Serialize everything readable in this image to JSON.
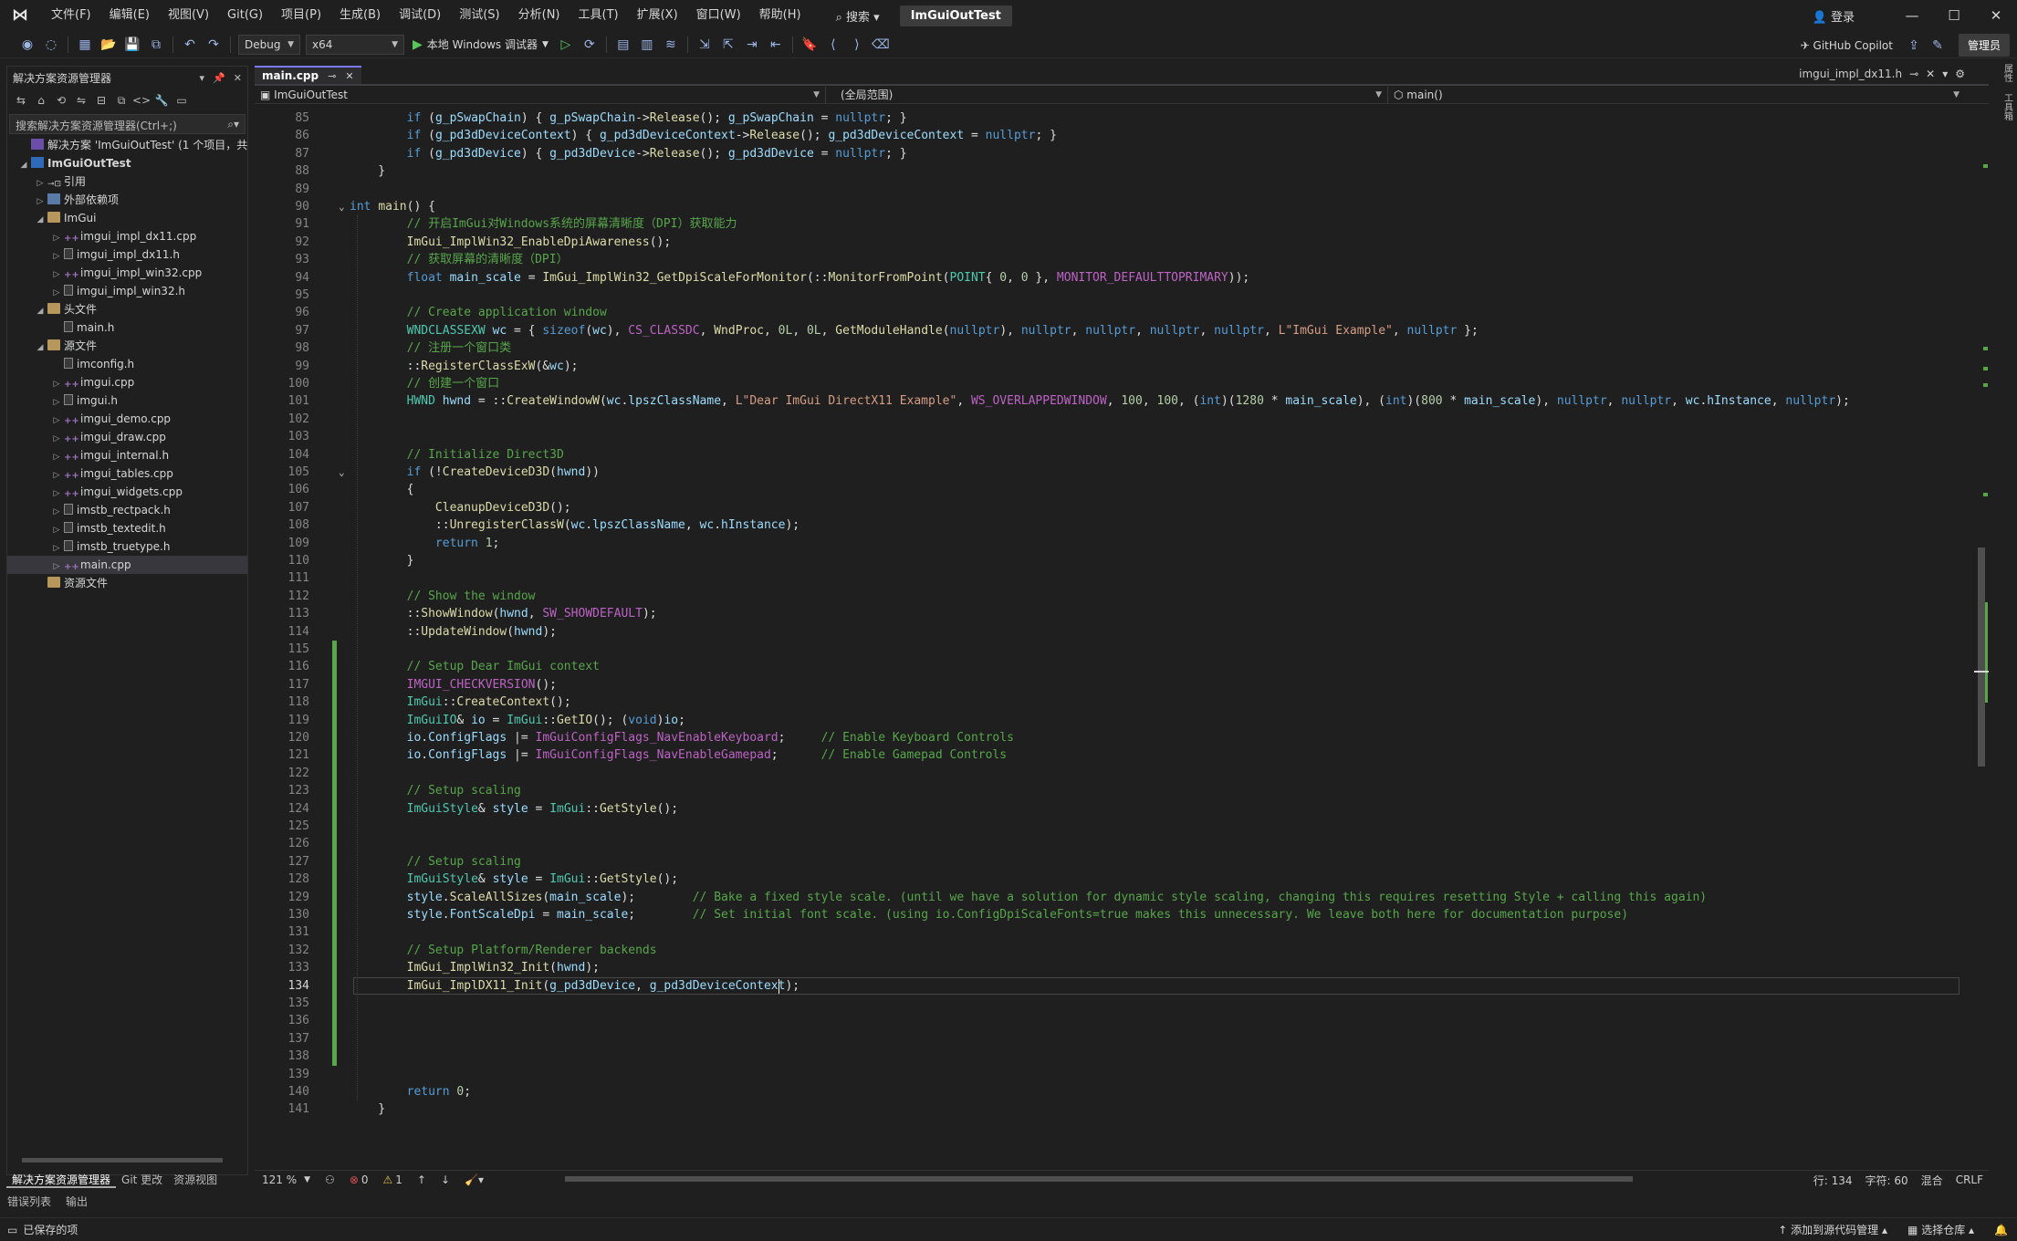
{
  "titlebar": {
    "menus": [
      "文件(F)",
      "编辑(E)",
      "视图(V)",
      "Git(G)",
      "项目(P)",
      "生成(B)",
      "调试(D)",
      "测试(S)",
      "分析(N)",
      "工具(T)",
      "扩展(X)",
      "窗口(W)",
      "帮助(H)"
    ],
    "search_label": "搜索",
    "solution_name": "ImGuiOutTest",
    "login": "登录"
  },
  "toolbar": {
    "config": "Debug",
    "platform": "x64",
    "run_label": "本地 Windows 调试器",
    "copilot": "GitHub Copilot",
    "admin": "管理员"
  },
  "solution_explorer": {
    "title": "解决方案资源管理器",
    "search_placeholder": "搜索解决方案资源管理器(Ctrl+;)",
    "items": [
      {
        "label": "解决方案 'ImGuiOutTest' (1 个项目，共 1",
        "indent": 0,
        "icon": "sln",
        "exp": ""
      },
      {
        "label": "ImGuiOutTest",
        "indent": 0,
        "icon": "proj",
        "exp": "◢",
        "bold": true
      },
      {
        "label": "引用",
        "indent": 1,
        "icon": "ref",
        "exp": "▷"
      },
      {
        "label": "外部依赖项",
        "indent": 1,
        "icon": "ext",
        "exp": "▷"
      },
      {
        "label": "ImGui",
        "indent": 1,
        "icon": "folder",
        "exp": "◢"
      },
      {
        "label": "imgui_impl_dx11.cpp",
        "indent": 2,
        "icon": "cpp",
        "exp": "▷"
      },
      {
        "label": "imgui_impl_dx11.h",
        "indent": 2,
        "icon": "h",
        "exp": "▷"
      },
      {
        "label": "imgui_impl_win32.cpp",
        "indent": 2,
        "icon": "cpp",
        "exp": "▷"
      },
      {
        "label": "imgui_impl_win32.h",
        "indent": 2,
        "icon": "h",
        "exp": "▷"
      },
      {
        "label": "头文件",
        "indent": 1,
        "icon": "folder",
        "exp": "◢"
      },
      {
        "label": "main.h",
        "indent": 2,
        "icon": "h",
        "exp": ""
      },
      {
        "label": "源文件",
        "indent": 1,
        "icon": "folder",
        "exp": "◢"
      },
      {
        "label": "imconfig.h",
        "indent": 2,
        "icon": "h",
        "exp": ""
      },
      {
        "label": "imgui.cpp",
        "indent": 2,
        "icon": "cpp",
        "exp": "▷"
      },
      {
        "label": "imgui.h",
        "indent": 2,
        "icon": "h",
        "exp": "▷"
      },
      {
        "label": "imgui_demo.cpp",
        "indent": 2,
        "icon": "cpp",
        "exp": "▷"
      },
      {
        "label": "imgui_draw.cpp",
        "indent": 2,
        "icon": "cpp",
        "exp": "▷"
      },
      {
        "label": "imgui_internal.h",
        "indent": 2,
        "icon": "cpp",
        "exp": "▷"
      },
      {
        "label": "imgui_tables.cpp",
        "indent": 2,
        "icon": "cpp",
        "exp": "▷"
      },
      {
        "label": "imgui_widgets.cpp",
        "indent": 2,
        "icon": "cpp",
        "exp": "▷"
      },
      {
        "label": "imstb_rectpack.h",
        "indent": 2,
        "icon": "h",
        "exp": "▷"
      },
      {
        "label": "imstb_textedit.h",
        "indent": 2,
        "icon": "h",
        "exp": "▷"
      },
      {
        "label": "imstb_truetype.h",
        "indent": 2,
        "icon": "h",
        "exp": "▷"
      },
      {
        "label": "main.cpp",
        "indent": 2,
        "icon": "cpp",
        "exp": "▷",
        "selected": true
      },
      {
        "label": "资源文件",
        "indent": 1,
        "icon": "folder",
        "exp": ""
      }
    ],
    "tabs": [
      "解决方案资源管理器",
      "Git 更改",
      "资源视图"
    ]
  },
  "editor": {
    "active_tab": "main.cpp",
    "right_tab": "imgui_impl_dx11.h",
    "nav_project": "ImGuiOutTest",
    "nav_scope": "(全局范围)",
    "nav_member": "main()",
    "current_line": 134
  },
  "code_lines": [
    {
      "n": 85,
      "h": "        <span class=\"kw\">if</span> (<span class=\"va\">g_pSwapChain</span>) { <span class=\"va\">g_pSwapChain</span>-&gt;<span class=\"fn\">Release</span>(); <span class=\"va\">g_pSwapChain</span> = <span class=\"kw\">nullptr</span>; }"
    },
    {
      "n": 86,
      "h": "        <span class=\"kw\">if</span> (<span class=\"va\">g_pd3dDeviceContext</span>) { <span class=\"va\">g_pd3dDeviceContext</span>-&gt;<span class=\"fn\">Release</span>(); <span class=\"va\">g_pd3dDeviceContext</span> = <span class=\"kw\">nullptr</span>; }"
    },
    {
      "n": 87,
      "h": "        <span class=\"kw\">if</span> (<span class=\"va\">g_pd3dDevice</span>) { <span class=\"va\">g_pd3dDevice</span>-&gt;<span class=\"fn\">Release</span>(); <span class=\"va\">g_pd3dDevice</span> = <span class=\"kw\">nullptr</span>; }"
    },
    {
      "n": 88,
      "h": "    }"
    },
    {
      "n": 89,
      "h": ""
    },
    {
      "n": 90,
      "h": "<span class=\"kw\">int</span> <span class=\"fn\">main</span>() {",
      "fold": true
    },
    {
      "n": 91,
      "h": "        <span class=\"cm\">// 开启ImGui对Windows系统的屏幕清晰度（DPI）获取能力</span>"
    },
    {
      "n": 92,
      "h": "        <span class=\"fn\">ImGui_ImplWin32_EnableDpiAwareness</span>();"
    },
    {
      "n": 93,
      "h": "        <span class=\"cm\">// 获取屏幕的清晰度（DPI）</span>"
    },
    {
      "n": 94,
      "h": "        <span class=\"kw\">float</span> <span class=\"va\">main_scale</span> = <span class=\"fn\">ImGui_ImplWin32_GetDpiScaleForMonitor</span>(::<span class=\"fn\">MonitorFromPoint</span>(<span class=\"ty\">POINT</span>{ <span class=\"nm\">0</span>, <span class=\"nm\">0</span> }, <span class=\"mc\">MONITOR_DEFAULTTOPRIMARY</span>));"
    },
    {
      "n": 95,
      "h": ""
    },
    {
      "n": 96,
      "h": "        <span class=\"cm\">// Create application window</span>"
    },
    {
      "n": 97,
      "h": "        <span class=\"ty\">WNDCLASSEXW</span> <span class=\"va\">wc</span> = { <span class=\"kw\">sizeof</span>(<span class=\"va\">wc</span>), <span class=\"mc\">CS_CLASSDC</span>, <span class=\"fn\">WndProc</span>, <span class=\"nm\">0L</span>, <span class=\"nm\">0L</span>, <span class=\"fn\">GetModuleHandle</span>(<span class=\"kw\">nullptr</span>), <span class=\"kw\">nullptr</span>, <span class=\"kw\">nullptr</span>, <span class=\"kw\">nullptr</span>, <span class=\"kw\">nullptr</span>, <span class=\"st\">L\"ImGui Example\"</span>, <span class=\"kw\">nullptr</span> };"
    },
    {
      "n": 98,
      "h": "        <span class=\"cm\">// 注册一个窗口类</span>"
    },
    {
      "n": 99,
      "h": "        ::<span class=\"fn\">RegisterClassExW</span>(&amp;<span class=\"va\">wc</span>);"
    },
    {
      "n": 100,
      "h": "        <span class=\"cm\">// 创建一个窗口</span>"
    },
    {
      "n": 101,
      "h": "        <span class=\"ty\">HWND</span> <span class=\"va\">hwnd</span> = ::<span class=\"fn\">CreateWindowW</span>(<span class=\"va\">wc</span>.<span class=\"va\">lpszClassName</span>, <span class=\"st\">L\"Dear ImGui DirectX11 Example\"</span>, <span class=\"mc\">WS_OVERLAPPEDWINDOW</span>, <span class=\"nm\">100</span>, <span class=\"nm\">100</span>, (<span class=\"kw\">int</span>)(<span class=\"nm\">1280</span> * <span class=\"va\">main_scale</span>), (<span class=\"kw\">int</span>)(<span class=\"nm\">800</span> * <span class=\"va\">main_scale</span>), <span class=\"kw\">nullptr</span>, <span class=\"kw\">nullptr</span>, <span class=\"va\">wc</span>.<span class=\"va\">hInstance</span>, <span class=\"kw\">nullptr</span>);"
    },
    {
      "n": 102,
      "h": ""
    },
    {
      "n": 103,
      "h": ""
    },
    {
      "n": 104,
      "h": "        <span class=\"cm\">// Initialize Direct3D</span>"
    },
    {
      "n": 105,
      "h": "        <span class=\"kw\">if</span> (!<span class=\"fn\">CreateDeviceD3D</span>(<span class=\"va\">hwnd</span>))",
      "fold": true
    },
    {
      "n": 106,
      "h": "        {"
    },
    {
      "n": 107,
      "h": "            <span class=\"fn\">CleanupDeviceD3D</span>();"
    },
    {
      "n": 108,
      "h": "            ::<span class=\"fn\">UnregisterClassW</span>(<span class=\"va\">wc</span>.<span class=\"va\">lpszClassName</span>, <span class=\"va\">wc</span>.<span class=\"va\">hInstance</span>);"
    },
    {
      "n": 109,
      "h": "            <span class=\"kw\">return</span> <span class=\"nm\">1</span>;"
    },
    {
      "n": 110,
      "h": "        }"
    },
    {
      "n": 111,
      "h": ""
    },
    {
      "n": 112,
      "h": "        <span class=\"cm\">// Show the window</span>"
    },
    {
      "n": 113,
      "h": "        ::<span class=\"fn\">ShowWindow</span>(<span class=\"va\">hwnd</span>, <span class=\"mc\">SW_SHOWDEFAULT</span>);"
    },
    {
      "n": 114,
      "h": "        ::<span class=\"fn\">UpdateWindow</span>(<span class=\"va\">hwnd</span>);"
    },
    {
      "n": 115,
      "h": ""
    },
    {
      "n": 116,
      "h": "        <span class=\"cm\">// Setup Dear ImGui context</span>"
    },
    {
      "n": 117,
      "h": "        <span class=\"mc\">IMGUI_CHECKVERSION</span>();"
    },
    {
      "n": 118,
      "h": "        <span class=\"ty\">ImGui</span>::<span class=\"fn\">CreateContext</span>();"
    },
    {
      "n": 119,
      "h": "        <span class=\"ty\">ImGuiIO</span>&amp; <span class=\"va\">io</span> = <span class=\"ty\">ImGui</span>::<span class=\"fn\">GetIO</span>(); (<span class=\"kw\">void</span>)<span class=\"va\">io</span>;"
    },
    {
      "n": 120,
      "h": "        <span class=\"va\">io</span>.<span class=\"va\">ConfigFlags</span> |= <span class=\"mc\">ImGuiConfigFlags_NavEnableKeyboard</span>;     <span class=\"cm\">// Enable Keyboard Controls</span>"
    },
    {
      "n": 121,
      "h": "        <span class=\"va\">io</span>.<span class=\"va\">ConfigFlags</span> |= <span class=\"mc\">ImGuiConfigFlags_NavEnableGamepad</span>;      <span class=\"cm\">// Enable Gamepad Controls</span>"
    },
    {
      "n": 122,
      "h": ""
    },
    {
      "n": 123,
      "h": "        <span class=\"cm\">// Setup scaling</span>"
    },
    {
      "n": 124,
      "h": "        <span class=\"ty\">ImGuiStyle</span>&amp; <span class=\"va\">style</span> = <span class=\"ty\">ImGui</span>::<span class=\"fn\">GetStyle</span>();"
    },
    {
      "n": 125,
      "h": ""
    },
    {
      "n": 126,
      "h": ""
    },
    {
      "n": 127,
      "h": "        <span class=\"cm\">// Setup scaling</span>"
    },
    {
      "n": 128,
      "h": "        <span class=\"ty\">ImGuiStyle</span>&amp; <span class=\"va\">style</span> = <span class=\"ty\">ImGui</span>::<span class=\"fn\">GetStyle</span>();"
    },
    {
      "n": 129,
      "h": "        <span class=\"va\">style</span>.<span class=\"fn\">ScaleAllSizes</span>(<span class=\"va\">main_scale</span>);        <span class=\"cm\">// Bake a fixed style scale. (until we have a solution for dynamic style scaling, changing this requires resetting Style + calling this again)</span>"
    },
    {
      "n": 130,
      "h": "        <span class=\"va\">style</span>.<span class=\"va\">FontScaleDpi</span> = <span class=\"va\">main_scale</span>;        <span class=\"cm\">// Set initial font scale. (using io.ConfigDpiScaleFonts=true makes this unnecessary. We leave both here for documentation purpose)</span>"
    },
    {
      "n": 131,
      "h": ""
    },
    {
      "n": 132,
      "h": "        <span class=\"cm\">// Setup Platform/Renderer backends</span>"
    },
    {
      "n": 133,
      "h": "        <span class=\"fn\">ImGui_ImplWin32_Init</span>(<span class=\"va\">hwnd</span>);"
    },
    {
      "n": 134,
      "h": "        <span class=\"fn\">ImGui_ImplDX11_Init</span>(<span class=\"va\">g_pd3dDevice</span>, <span class=\"va\">g_pd3dDeviceContext</span>);"
    },
    {
      "n": 135,
      "h": ""
    },
    {
      "n": 136,
      "h": ""
    },
    {
      "n": 137,
      "h": ""
    },
    {
      "n": 138,
      "h": ""
    },
    {
      "n": 139,
      "h": ""
    },
    {
      "n": 140,
      "h": "        <span class=\"kw\">return</span> <span class=\"nm\">0</span>;"
    },
    {
      "n": 141,
      "h": "    }"
    }
  ],
  "status": {
    "zoom": "121 %",
    "errors": "0",
    "warnings": "1",
    "line": "行: 134",
    "col": "字符: 60",
    "mode": "混合",
    "eol": "CRLF"
  },
  "bottom_tabs": [
    "错误列表",
    "输出"
  ],
  "statusbar": {
    "saved": "已保存的项",
    "add_source": "添加到源代码管理",
    "select_repo": "选择仓库"
  },
  "right_rail": [
    "属性",
    "工具箱"
  ]
}
